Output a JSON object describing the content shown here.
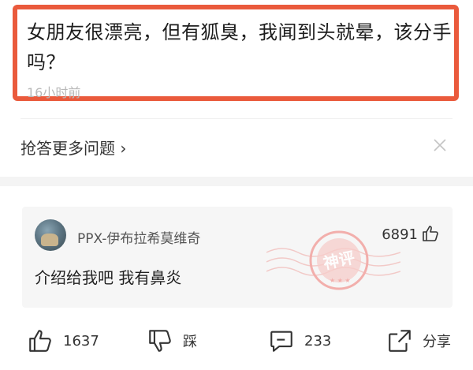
{
  "question": {
    "title": "女朋友很漂亮，但有狐臭，我闻到头就晕，该分手吗？",
    "time": "16小时前"
  },
  "more": {
    "label": "抢答更多问题 ›"
  },
  "comment": {
    "username": "PPX-伊布拉希莫维奇",
    "like_count": "6891",
    "text": "介绍给我吧 我有鼻炎",
    "stamp_text": "神评"
  },
  "actions": {
    "like_count": "1637",
    "dislike_label": "踩",
    "comment_count": "233",
    "share_label": "分享"
  },
  "colors": {
    "highlight_border": "#ea5a3c",
    "stamp": "#f2a3a0"
  }
}
